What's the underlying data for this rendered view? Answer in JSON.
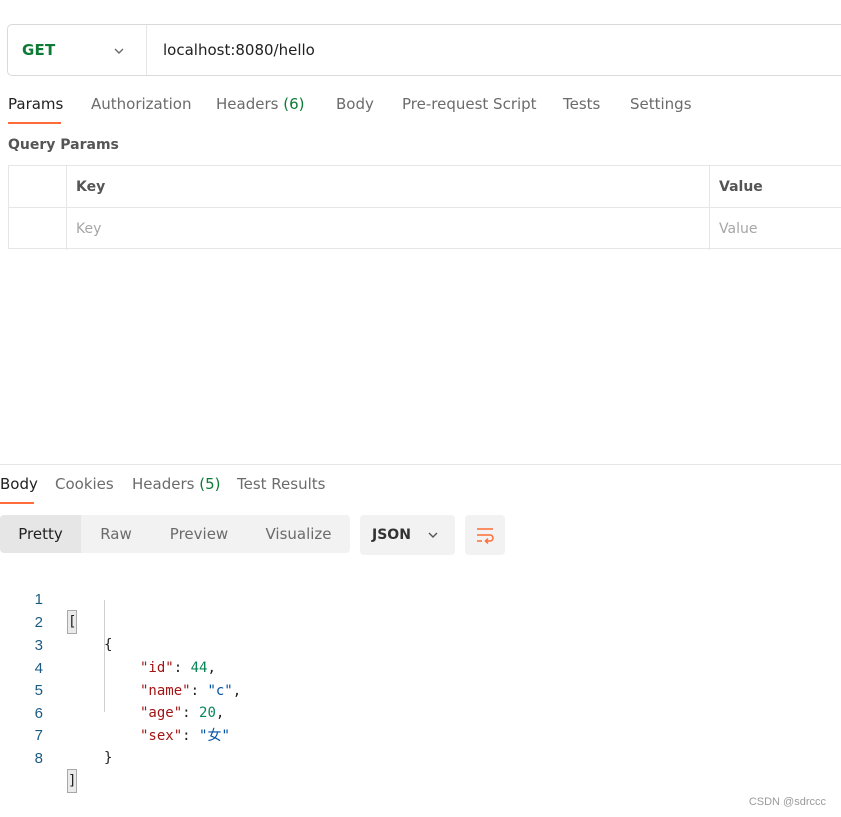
{
  "request": {
    "method": "GET",
    "url": "localhost:8080/hello"
  },
  "request_tabs": {
    "params": "Params",
    "authorization": "Authorization",
    "headers": "Headers",
    "headers_count": "(6)",
    "body": "Body",
    "pre_request": "Pre-request Script",
    "tests": "Tests",
    "settings": "Settings"
  },
  "query_params": {
    "title": "Query Params",
    "columns": {
      "key": "Key",
      "value": "Value"
    },
    "placeholder": {
      "key": "Key",
      "value": "Value"
    }
  },
  "response_tabs": {
    "body": "Body",
    "cookies": "Cookies",
    "headers": "Headers",
    "headers_count": "(5)",
    "test_results": "Test Results"
  },
  "format": {
    "pretty": "Pretty",
    "raw": "Raw",
    "preview": "Preview",
    "visualize": "Visualize",
    "language": "JSON"
  },
  "response_code": {
    "line_numbers": [
      "1",
      "2",
      "3",
      "4",
      "5",
      "6",
      "7",
      "8"
    ],
    "open_array": "[",
    "open_object": "{",
    "fields": [
      {
        "key": "\"id\"",
        "value": "44",
        "type": "number",
        "comma": ","
      },
      {
        "key": "\"name\"",
        "value": "\"c\"",
        "type": "string",
        "comma": ","
      },
      {
        "key": "\"age\"",
        "value": "20",
        "type": "number",
        "comma": ","
      },
      {
        "key": "\"sex\"",
        "value": "\"女\"",
        "type": "string",
        "comma": ""
      }
    ],
    "close_object": "}",
    "close_array": "]"
  },
  "watermark": "CSDN @sdrccc",
  "colors": {
    "accent": "#ff6c37",
    "method_green": "#0d7a35",
    "json_key": "#a31515",
    "json_number": "#098658",
    "json_string": "#0451a5"
  }
}
